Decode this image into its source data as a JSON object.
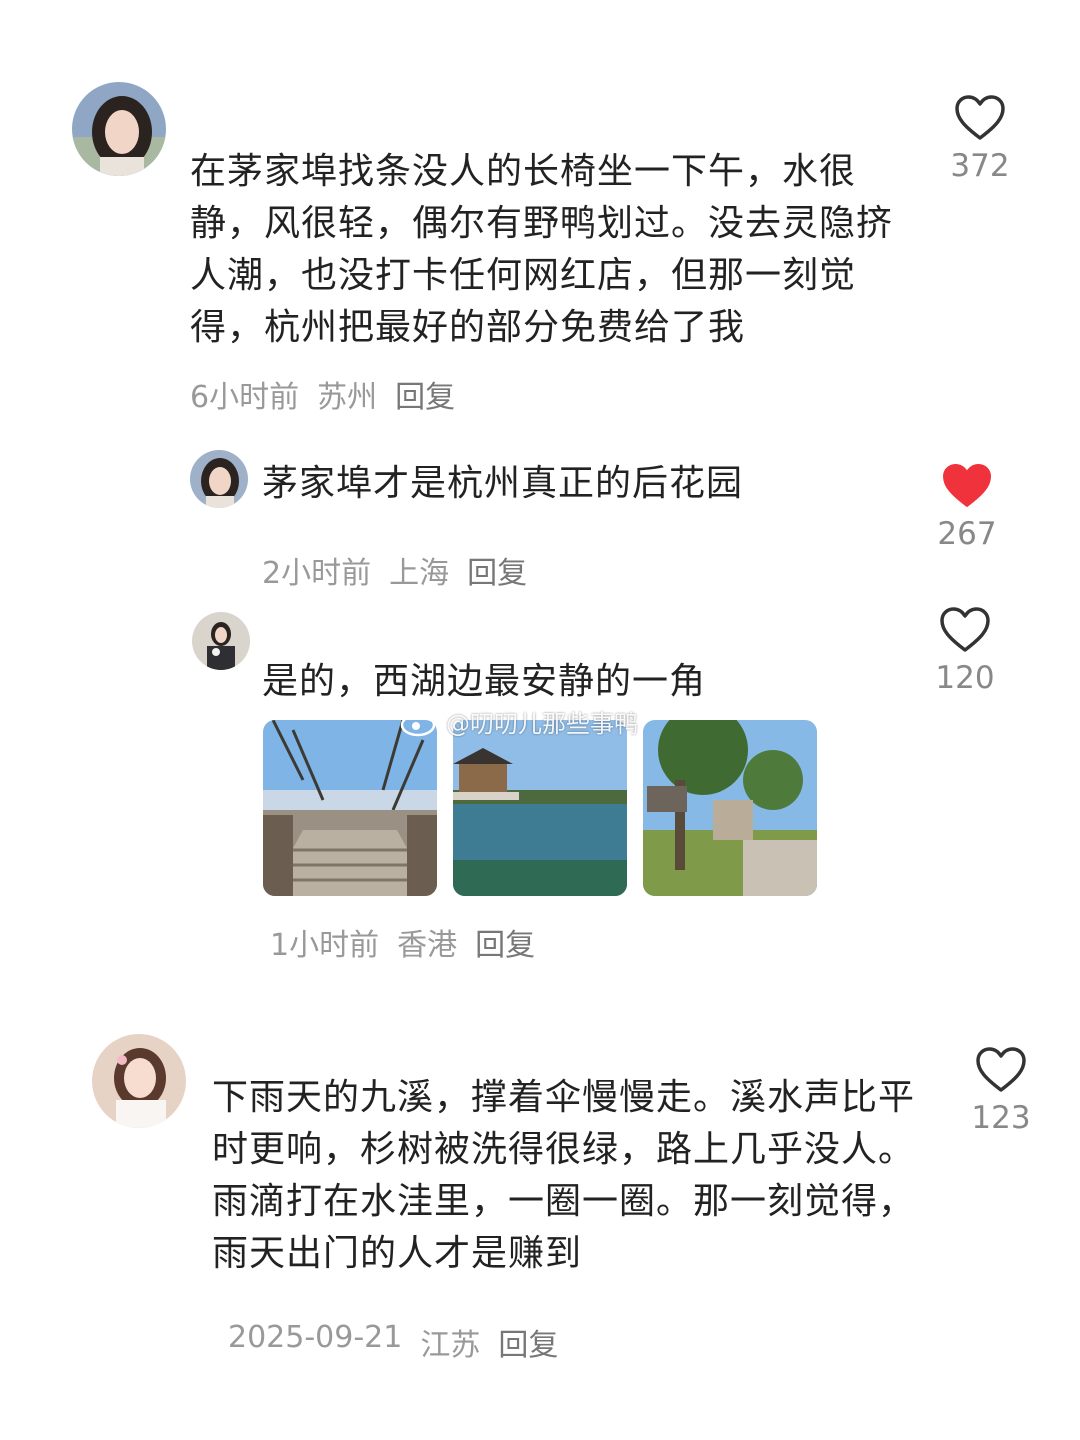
{
  "comments": [
    {
      "text": "在茅家埠找条没人的长椅坐一下午，水很静，风很轻，偶尔有野鸭划过。没去灵隐挤人潮，也没打卡任何网红店，但那一刻觉得，杭州把最好的部分免费给了我",
      "time": "6小时前",
      "location": "苏州",
      "reply_label": "回复",
      "likes": "372",
      "liked": false,
      "replies": [
        {
          "text": "茅家埠才是杭州真正的后花园",
          "time": "2小时前",
          "location": "上海",
          "reply_label": "回复",
          "likes": "267",
          "liked": true
        },
        {
          "text": "是的，西湖边最安静的一角",
          "time": "1小时前",
          "location": "香港",
          "reply_label": "回复",
          "likes": "120",
          "liked": false,
          "images": [
            "stone-bridge-steps",
            "lake-pavilion",
            "park-tree-sign"
          ]
        }
      ]
    },
    {
      "text": "下雨天的九溪，撑着伞慢慢走。溪水声比平时更响，杉树被洗得很绿，路上几乎没人。雨滴打在水洼里，一圈一圈。那一刻觉得，雨天出门的人才是赚到",
      "time": "2025-09-21",
      "location": "江苏",
      "reply_label": "回复",
      "likes": "123",
      "liked": false
    }
  ],
  "watermark": "@叨叨儿那些事鸭",
  "colors": {
    "liked_heart": "#f0323c",
    "outline_heart": "#333333",
    "meta_text": "#999999"
  }
}
